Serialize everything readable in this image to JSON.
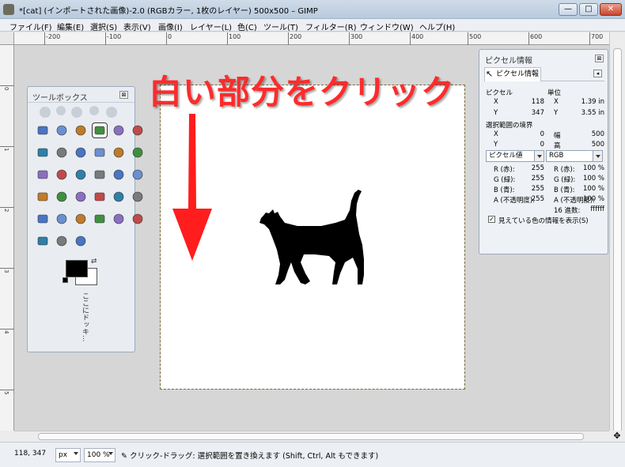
{
  "window": {
    "title": "*[cat] (インポートされた画像)-2.0 (RGBカラー, 1枚のレイヤー) 500x500 – GIMP",
    "minimize": "—",
    "maximize": "□",
    "close": "✕"
  },
  "menu": [
    "ファイル(F)",
    "編集(E)",
    "選択(S)",
    "表示(V)",
    "画像(I)",
    "レイヤー(L)",
    "色(C)",
    "ツール(T)",
    "フィルター(R)",
    "ウィンドウ(W)",
    "ヘルプ(H)"
  ],
  "ruler": {
    "h_labels": [
      "-200",
      "-100",
      "0",
      "100",
      "200",
      "300",
      "400",
      "500",
      "600",
      "700"
    ],
    "v_labels": [
      "0",
      "1",
      "2",
      "3",
      "4",
      "5"
    ]
  },
  "annotation": {
    "text": "白い部分をクリック",
    "color": "#ff2b2b"
  },
  "toolbox": {
    "title": "ツールボックス",
    "close": "⊠",
    "tools": [
      "rect-select-icon",
      "ellipse-select-icon",
      "free-select-icon",
      "fuzzy-select-icon",
      "scissors-select-icon",
      "foreground-select-icon",
      "paths-icon",
      "color-picker-icon",
      "zoom-icon",
      "measure-icon",
      "move-icon",
      "align-icon",
      "crop-icon",
      "rotate-icon",
      "scale-icon",
      "shear-icon",
      "perspective-icon",
      "flip-icon",
      "cage-transform-icon",
      "text-icon",
      "bucket-fill-icon",
      "blend-icon",
      "pencil-icon",
      "paintbrush-icon",
      "eraser-icon",
      "airbrush-icon",
      "ink-icon",
      "clone-icon",
      "heal-icon",
      "perspective-clone-icon",
      "blur-icon",
      "smudge-icon",
      "dodge-burn-icon"
    ],
    "active_tool": "fuzzy-select-icon",
    "fg_color": "#000000",
    "bg_color": "#ffffff",
    "dock_hint": "ここにドッキ..."
  },
  "pixel_info": {
    "title": "ピクセル情報",
    "close": "⊠",
    "tab_label": "ピクセル情報",
    "pixel_header": "ピクセル",
    "unit_header": "単位",
    "pixel_x_label": "X",
    "pixel_x": "118",
    "pixel_y_label": "Y",
    "pixel_y": "347",
    "unit_x_label": "X",
    "unit_x": "1.39 in",
    "unit_y_label": "Y",
    "unit_y": "3.55 in",
    "selection_header": "選択範囲の境界",
    "sel_x_label": "X",
    "sel_x": "0",
    "sel_y_label": "Y",
    "sel_y": "0",
    "sel_w_label": "幅",
    "sel_w": "500",
    "sel_h_label": "高",
    "sel_h": "500",
    "left_mode": "ピクセル値",
    "right_mode": "RGB",
    "left_rows": [
      {
        "label": "R (赤):",
        "value": "255"
      },
      {
        "label": "G (緑):",
        "value": "255"
      },
      {
        "label": "B (青):",
        "value": "255"
      },
      {
        "label": "A (不透明度):",
        "value": "255"
      }
    ],
    "right_rows": [
      {
        "label": "R (赤):",
        "value": "100 %"
      },
      {
        "label": "G (緑):",
        "value": "100 %"
      },
      {
        "label": "B (青):",
        "value": "100 %"
      },
      {
        "label": "A (不透明度):",
        "value": "100 %"
      },
      {
        "label": "16 進数:",
        "value": "ffffff"
      }
    ],
    "checkbox_label": "見えている色の情報を表示(S)",
    "checkbox_checked": "✓"
  },
  "statusbar": {
    "coords": "118, 347",
    "unit": "px",
    "zoom": "100 %",
    "message": "クリック-ドラッグ: 選択範囲を置き換えます (Shift, Ctrl, Alt もできます)"
  },
  "scroll": {
    "nav": "✥"
  }
}
